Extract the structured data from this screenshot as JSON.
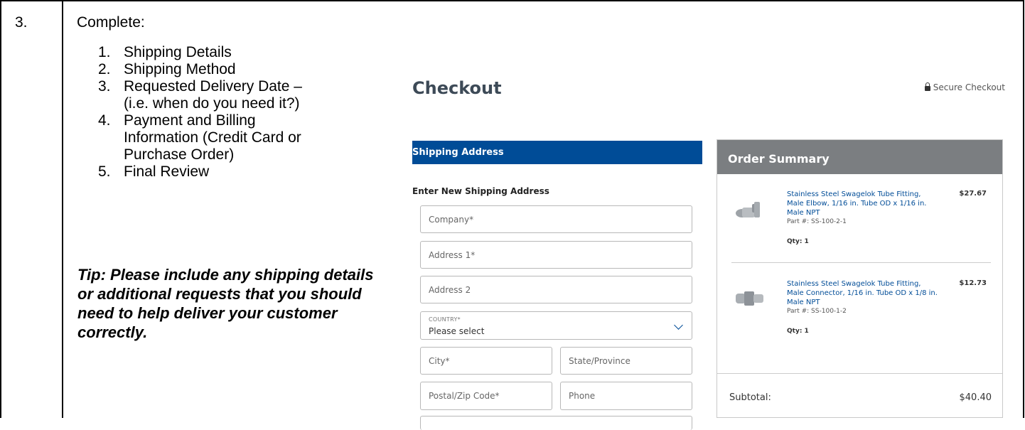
{
  "doc": {
    "step_number": "3.",
    "title": "Complete:",
    "steps": [
      {
        "n": "1.",
        "text": "Shipping Details"
      },
      {
        "n": "2.",
        "text": "Shipping Method"
      },
      {
        "n": "3.",
        "text": "Requested Delivery Date –"
      },
      {
        "n": "",
        "text": "(i.e. when do you need it?)"
      },
      {
        "n": "4.",
        "text": "Payment and Billing"
      },
      {
        "n": "",
        "text": "Information (Credit Card or"
      },
      {
        "n": "",
        "text": "Purchase Order)"
      },
      {
        "n": "5.",
        "text": "Final Review"
      }
    ],
    "tip": "Tip: Please include any shipping details or additional requests that you should need to help deliver your customer correctly."
  },
  "checkout": {
    "title": "Checkout",
    "secure_label": "Secure Checkout",
    "shipping_bar": "Shipping Address",
    "enter_label": "Enter New Shipping Address",
    "fields": {
      "company": "Company*",
      "address1": "Address 1*",
      "address2": "Address 2",
      "country_label": "COUNTRY*",
      "country_value": "Please select",
      "city": "City*",
      "state": "State/Province",
      "postal": "Postal/Zip Code*",
      "phone": "Phone"
    }
  },
  "summary": {
    "title": "Order Summary",
    "items": [
      {
        "name": "Stainless Steel Swagelok Tube Fitting, Male Elbow, 1/16 in. Tube OD x 1/16 in. Male NPT",
        "price": "$27.67",
        "part": "Part #: SS-100-2-1",
        "qty": "Qty: 1"
      },
      {
        "name": "Stainless Steel Swagelok Tube Fitting, Male Connector, 1/16 in. Tube OD x 1/8 in. Male NPT",
        "price": "$12.73",
        "part": "Part #: SS-100-1-2",
        "qty": "Qty: 1"
      }
    ],
    "subtotal_label": "Subtotal:",
    "subtotal_value": "$40.40"
  },
  "colors": {
    "brand_blue": "#004c97",
    "summary_header": "#7b7e81"
  },
  "icons": [
    "lock-icon",
    "chevron-down-icon"
  ]
}
